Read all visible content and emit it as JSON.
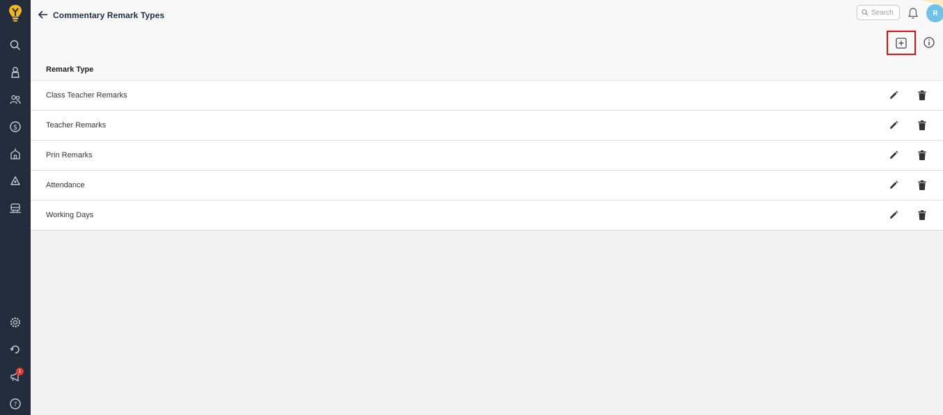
{
  "header": {
    "title": "Commentary Remark Types",
    "search_placeholder": "Search",
    "avatar_initial": "R"
  },
  "sidebar": {
    "notification_badge": "1",
    "items": [
      {
        "icon": "search-icon"
      },
      {
        "icon": "student-icon"
      },
      {
        "icon": "people-icon"
      },
      {
        "icon": "dollar-icon"
      },
      {
        "icon": "school-icon"
      },
      {
        "icon": "recycle-icon"
      },
      {
        "icon": "transport-icon"
      },
      {
        "icon": "gear-icon"
      },
      {
        "icon": "refresh-icon"
      },
      {
        "icon": "megaphone-icon"
      },
      {
        "icon": "help-icon"
      }
    ]
  },
  "table": {
    "column_header": "Remark Type",
    "rows": [
      {
        "label": "Class Teacher Remarks"
      },
      {
        "label": "Teacher Remarks"
      },
      {
        "label": "Prin Remarks"
      },
      {
        "label": "Attendance"
      },
      {
        "label": "Working Days"
      }
    ]
  },
  "colors": {
    "sidebar_bg": "#232c3a",
    "highlight": "#e10e0e",
    "avatar_bg": "#6ec1e8",
    "logo": "#f5b61c"
  }
}
